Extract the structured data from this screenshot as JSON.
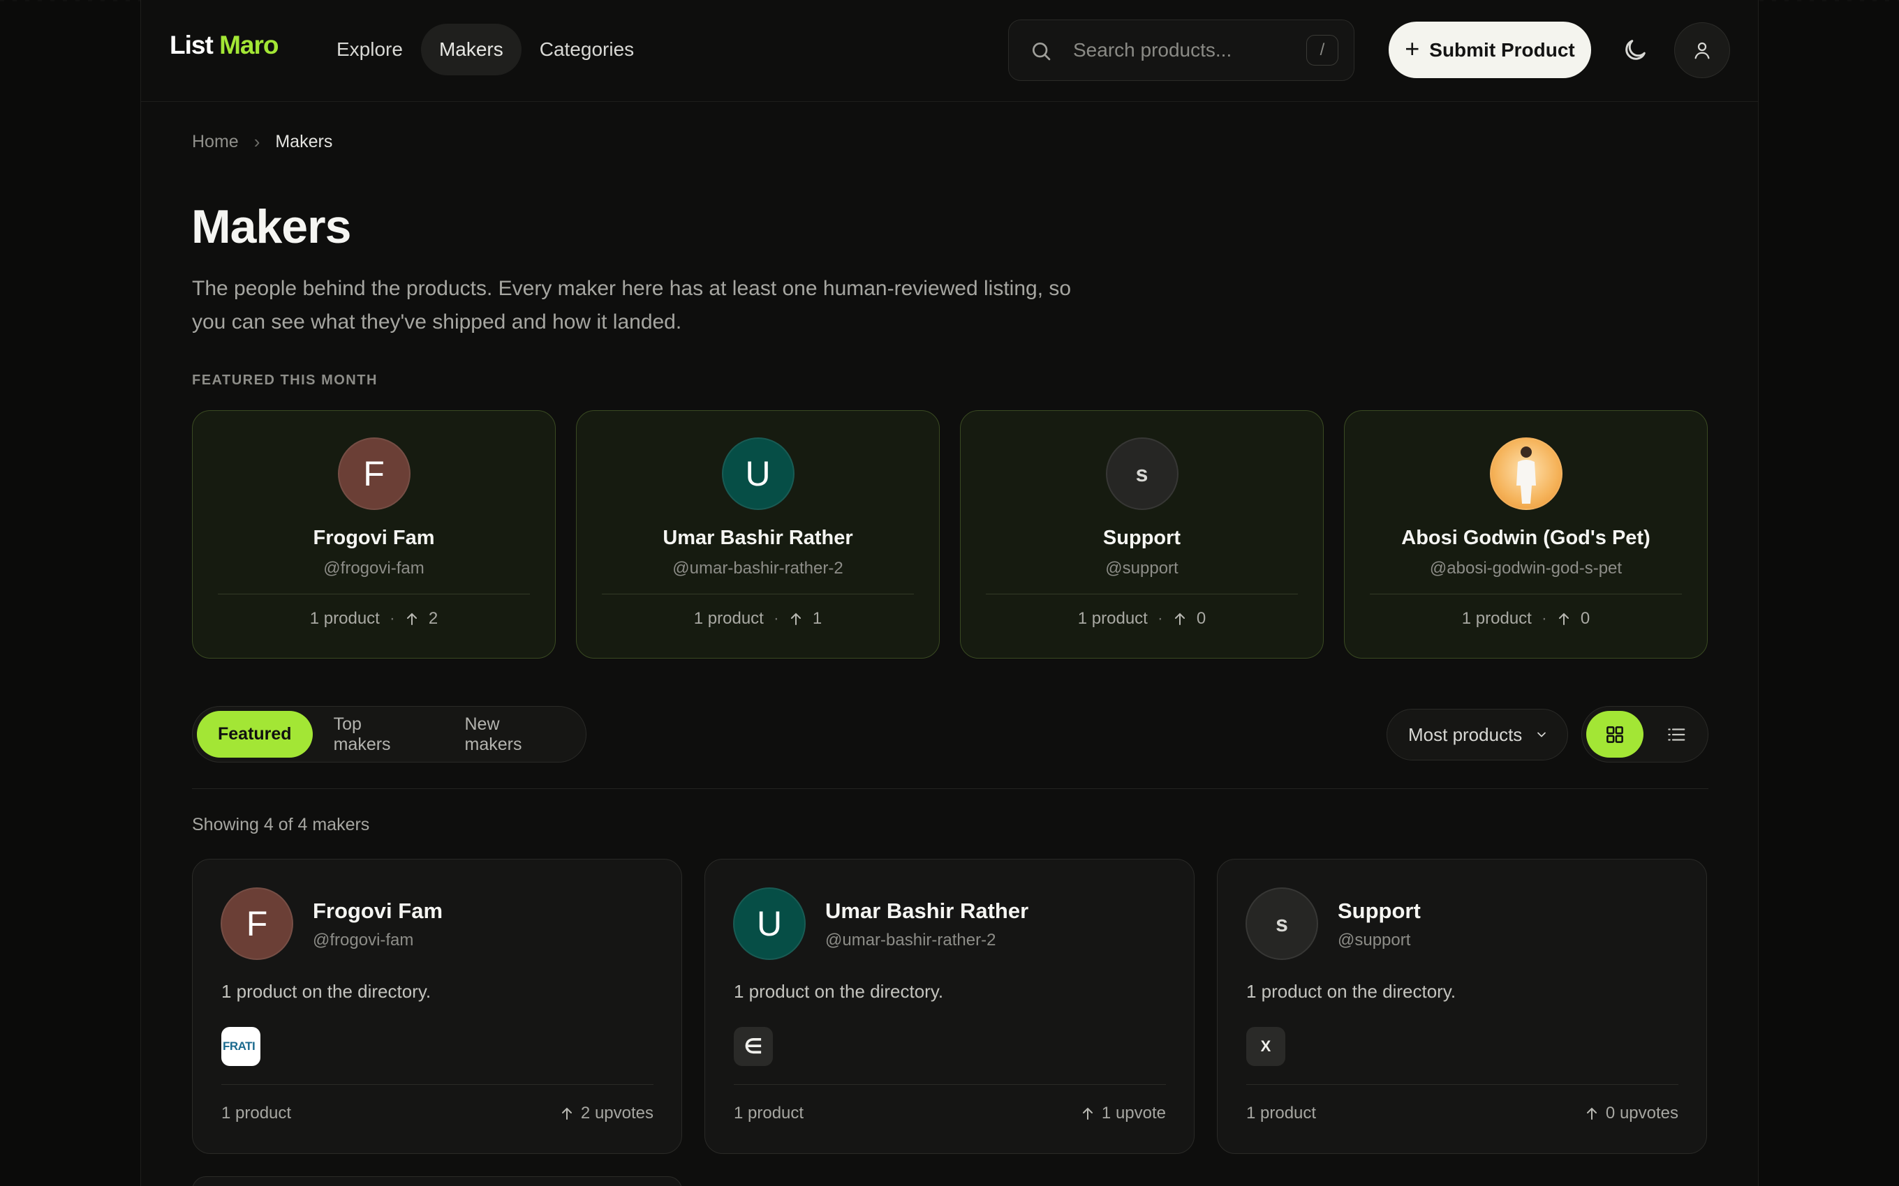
{
  "header": {
    "logo_part1": "List",
    "logo_part2": "Maro",
    "nav": [
      {
        "label": "Explore"
      },
      {
        "label": "Makers"
      },
      {
        "label": "Categories"
      }
    ],
    "search_placeholder": "Search products...",
    "search_shortcut": "/",
    "submit_label": "Submit Product",
    "icons": {
      "search": "search-icon",
      "theme": "moon-icon",
      "user": "user-icon",
      "plus": "plus-icon"
    }
  },
  "breadcrumb": {
    "home": "Home",
    "separator": "›",
    "current": "Makers"
  },
  "page": {
    "title": "Makers",
    "description": "The people behind the products. Every maker here has at least one human-reviewed listing, so you can see what they've shipped and how it landed."
  },
  "featured": {
    "label": "FEATURED THIS MONTH",
    "cards": [
      {
        "initial": "F",
        "name": "Frogovi Fam",
        "handle": "@frogovi-fam",
        "products": "1 product",
        "upvotes": "2",
        "avatar_color": "#6b3f36"
      },
      {
        "initial": "U",
        "name": "Umar Bashir Rather",
        "handle": "@umar-bashir-rather-2",
        "products": "1 product",
        "upvotes": "1",
        "avatar_color": "#064e46"
      },
      {
        "initial": "s",
        "name": "Support",
        "handle": "@support",
        "products": "1 product",
        "upvotes": "0",
        "avatar_color": "#262624"
      },
      {
        "initial": "",
        "name": "Abosi Godwin (God's Pet)",
        "handle": "@abosi-godwin-god-s-pet",
        "products": "1 product",
        "upvotes": "0",
        "avatar_color": "#f3a64a"
      }
    ]
  },
  "filters": {
    "tabs": [
      {
        "label": "Featured"
      },
      {
        "label": "Top makers"
      },
      {
        "label": "New makers"
      }
    ],
    "sort_label": "Most products",
    "views": {
      "grid": "grid-icon",
      "list": "list-icon"
    }
  },
  "results": {
    "showing": "Showing 4 of 4 makers",
    "makers": [
      {
        "initial": "F",
        "name": "Frogovi Fam",
        "handle": "@frogovi-fam",
        "description": "1 product on the directory.",
        "logo_text": "FRATI",
        "products": "1 product",
        "upvotes": "2 upvotes",
        "avatar_color": "#6b3f36"
      },
      {
        "initial": "U",
        "name": "Umar Bashir Rather",
        "handle": "@umar-bashir-rather-2",
        "description": "1 product on the directory.",
        "logo_text": "∈",
        "products": "1 product",
        "upvotes": "1 upvote",
        "avatar_color": "#064e46"
      },
      {
        "initial": "s",
        "name": "Support",
        "handle": "@support",
        "description": "1 product on the directory.",
        "logo_text": "X",
        "products": "1 product",
        "upvotes": "0 upvotes",
        "avatar_color": "#262624"
      }
    ]
  },
  "colors": {
    "accent": "#a3e635",
    "background": "#0e0e0d"
  }
}
